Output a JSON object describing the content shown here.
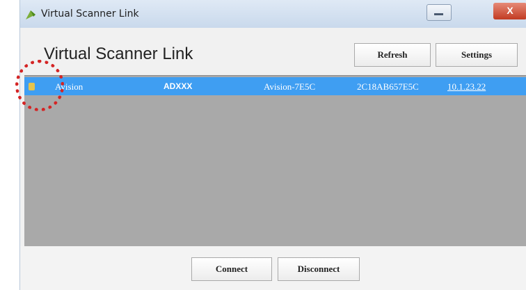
{
  "window": {
    "title": "Virtual Scanner Link",
    "close_glyph": "X",
    "minimize_icon": "minimize-icon"
  },
  "header": {
    "heading": "Virtual Scanner Link"
  },
  "toolbar": {
    "refresh_label": "Refresh",
    "settings_label": "Settings"
  },
  "devices": [
    {
      "name": "Avision",
      "model": "ADXXX",
      "host": "Avision-7E5C",
      "id": "2C18AB657E5C",
      "ip": "10.1.23.22",
      "icon": "scanner-device-icon"
    }
  ],
  "footer": {
    "connect_label": "Connect",
    "disconnect_label": "Disconnect"
  },
  "colors": {
    "selection": "#3f9ef2",
    "list_background": "#a9a9a9",
    "highlight": "#d42424"
  }
}
